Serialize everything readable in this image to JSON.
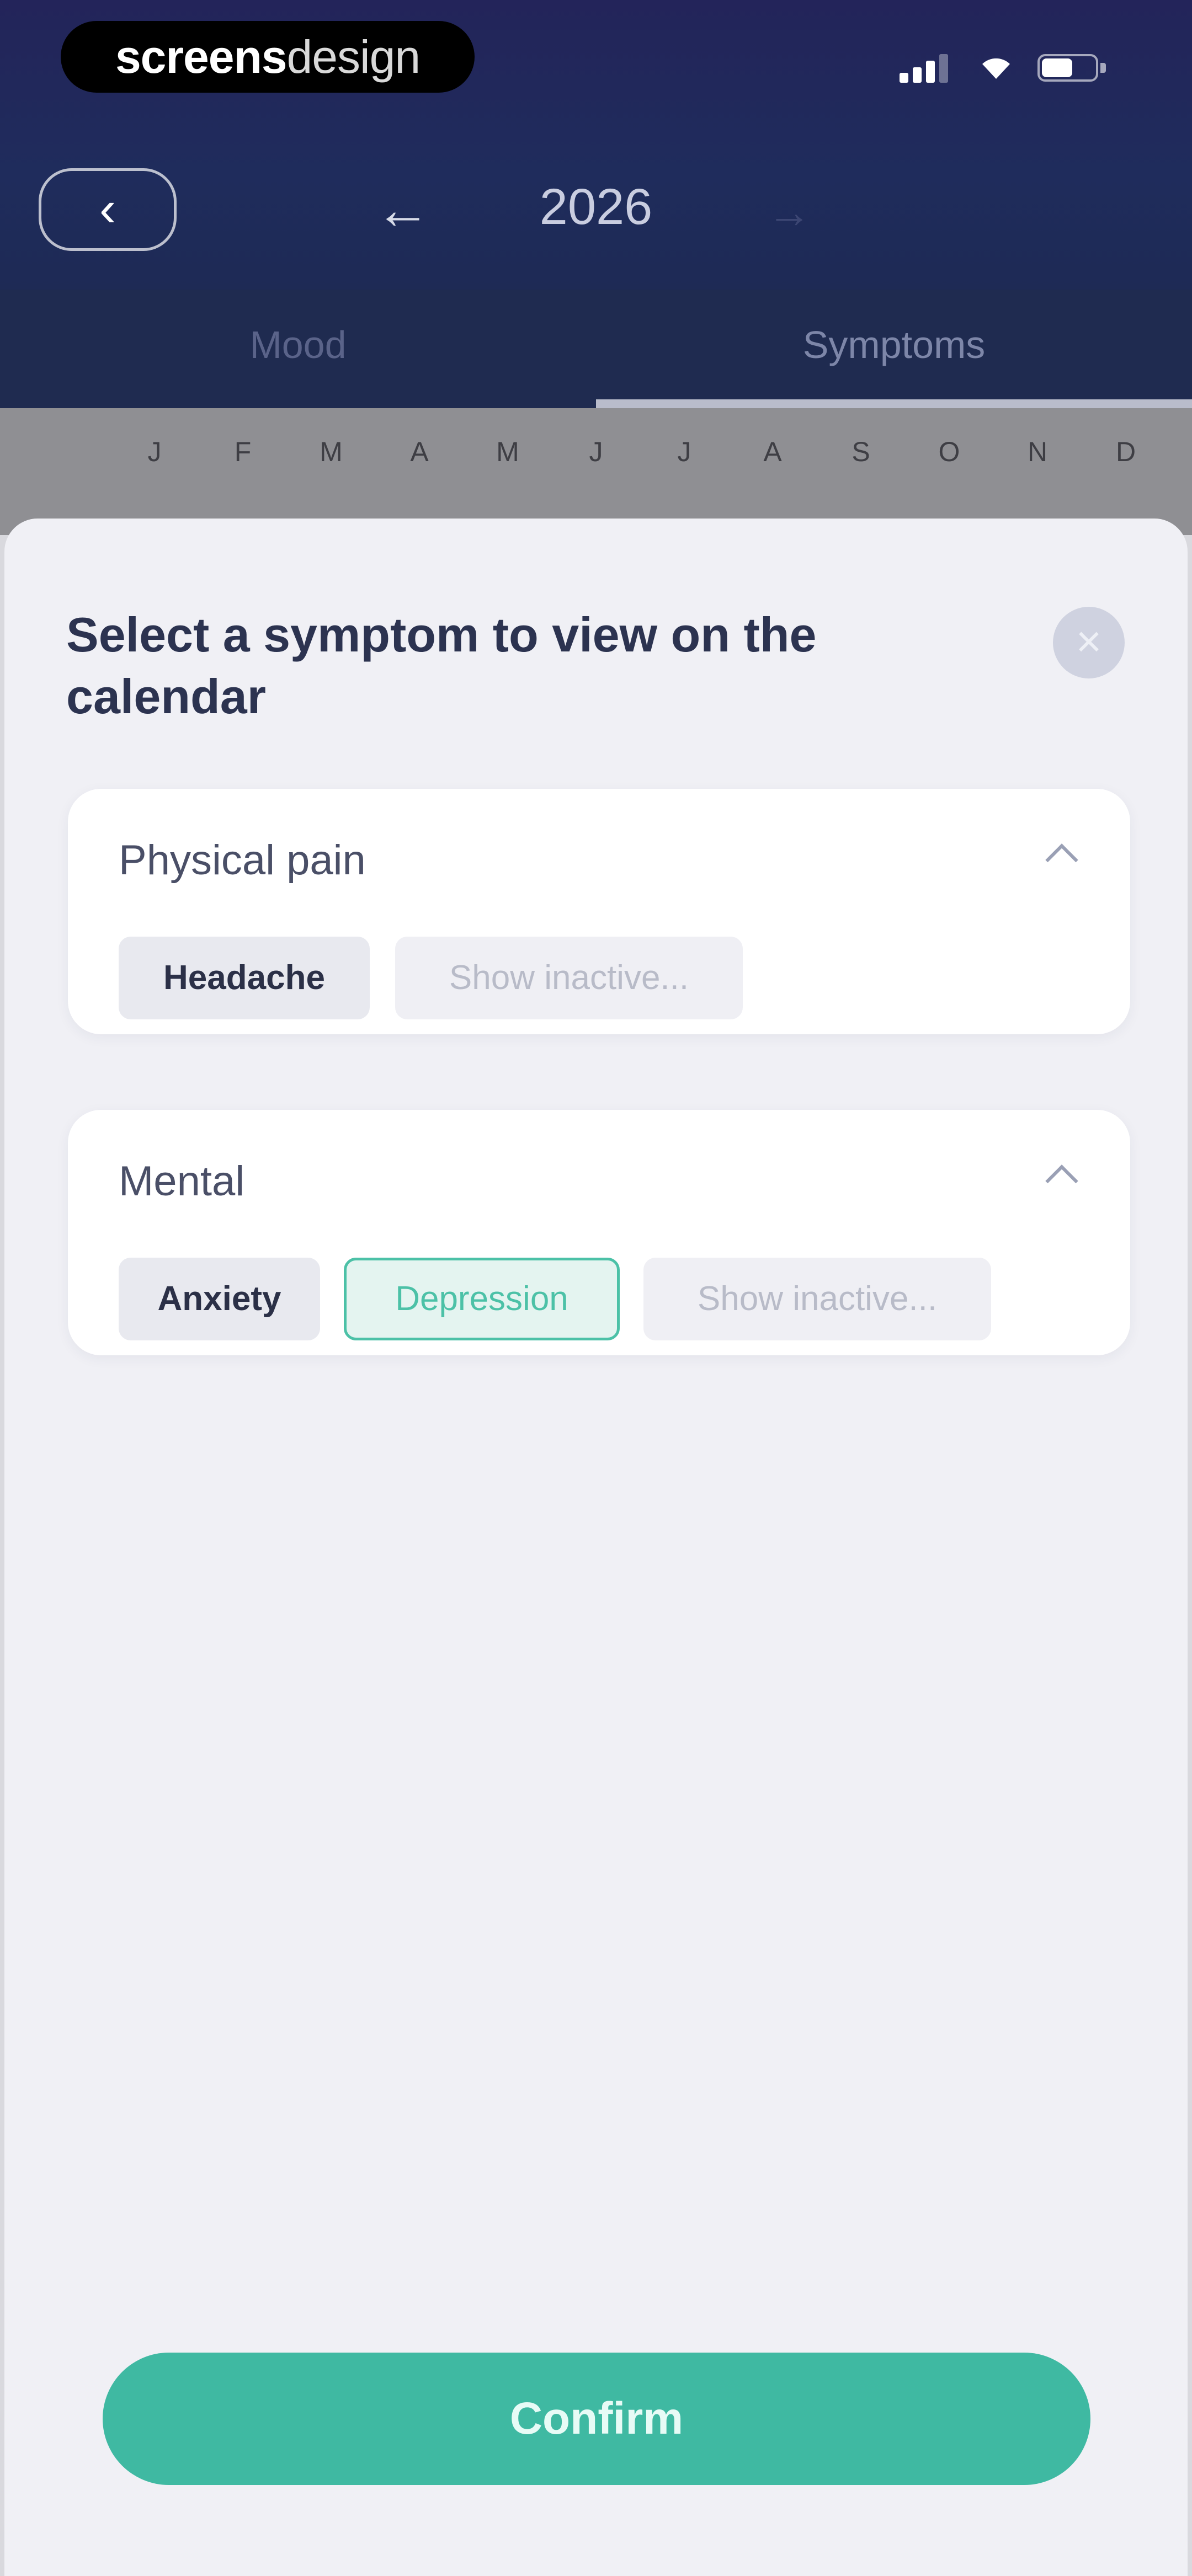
{
  "watermark": {
    "bold": "screens",
    "light": "design"
  },
  "header": {
    "year": "2026",
    "prev_icon": "arrow-left-icon",
    "next_icon": "arrow-right-icon",
    "back_icon": "chevron-left-icon"
  },
  "tabs": [
    {
      "label": "Mood"
    },
    {
      "label": "Symptoms"
    }
  ],
  "months": [
    "J",
    "F",
    "M",
    "A",
    "M",
    "J",
    "J",
    "A",
    "S",
    "O",
    "N",
    "D"
  ],
  "sheet": {
    "title": "Select a symptom to view on the calendar",
    "groups": [
      {
        "title": "Physical pain",
        "chips": [
          {
            "label": "Headache"
          },
          {
            "label": "Show inactive..."
          }
        ]
      },
      {
        "title": "Mental",
        "chips": [
          {
            "label": "Anxiety"
          },
          {
            "label": "Depression"
          },
          {
            "label": "Show inactive..."
          }
        ]
      }
    ],
    "confirm_label": "Confirm"
  },
  "colors": {
    "accent": "#3fb9a2",
    "header": "#23245a",
    "sheet_bg": "#f0f0f5"
  }
}
